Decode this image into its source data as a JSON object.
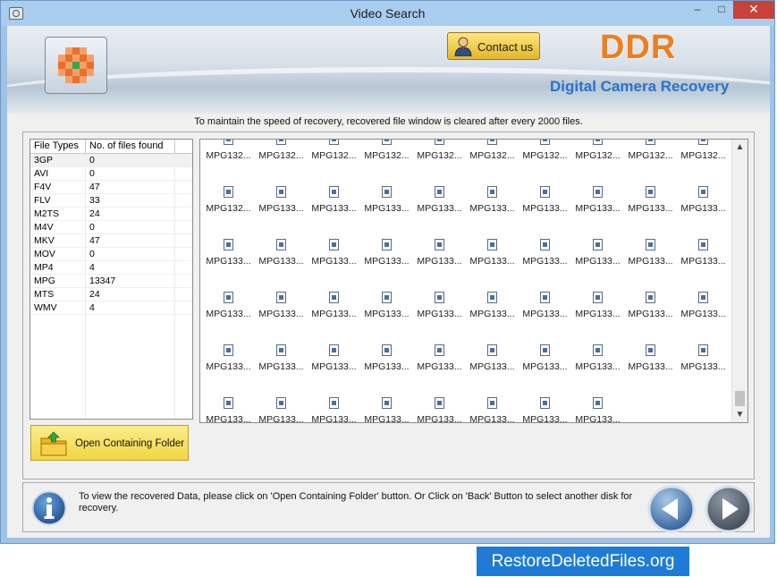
{
  "window": {
    "title": "Video Search",
    "minimize": "–",
    "maximize": "□",
    "close": "✕"
  },
  "header": {
    "contact_label": "Contact us",
    "brand": "DDR",
    "product": "Digital Camera Recovery"
  },
  "notice": "To maintain the speed of recovery, recovered file window is cleared after every 2000 files.",
  "file_types": {
    "columns": [
      "File Types",
      "No. of files found"
    ],
    "rows": [
      {
        "type": "3GP",
        "count": "0"
      },
      {
        "type": "AVI",
        "count": "0"
      },
      {
        "type": "F4V",
        "count": "47"
      },
      {
        "type": "FLV",
        "count": "33"
      },
      {
        "type": "M2TS",
        "count": "24"
      },
      {
        "type": "M4V",
        "count": "0"
      },
      {
        "type": "MKV",
        "count": "47"
      },
      {
        "type": "MOV",
        "count": "0"
      },
      {
        "type": "MP4",
        "count": "4"
      },
      {
        "type": "MPG",
        "count": "13347"
      },
      {
        "type": "MTS",
        "count": "24"
      },
      {
        "type": "WMV",
        "count": "4"
      }
    ]
  },
  "open_folder_label": "Open Containing Folder",
  "files": {
    "rows": [
      [
        "MPG132...",
        "MPG132...",
        "MPG132...",
        "MPG132...",
        "MPG132...",
        "MPG132...",
        "MPG132...",
        "MPG132...",
        "MPG132...",
        "MPG132..."
      ],
      [
        "MPG132...",
        "MPG133...",
        "MPG133...",
        "MPG133...",
        "MPG133...",
        "MPG133...",
        "MPG133...",
        "MPG133...",
        "MPG133...",
        "MPG133..."
      ],
      [
        "MPG133...",
        "MPG133...",
        "MPG133...",
        "MPG133...",
        "MPG133...",
        "MPG133...",
        "MPG133...",
        "MPG133...",
        "MPG133...",
        "MPG133..."
      ],
      [
        "MPG133...",
        "MPG133...",
        "MPG133...",
        "MPG133...",
        "MPG133...",
        "MPG133...",
        "MPG133...",
        "MPG133...",
        "MPG133...",
        "MPG133..."
      ],
      [
        "MPG133...",
        "MPG133...",
        "MPG133...",
        "MPG133...",
        "MPG133...",
        "MPG133...",
        "MPG133...",
        "MPG133...",
        "MPG133...",
        "MPG133..."
      ],
      [
        "MPG133...",
        "MPG133...",
        "MPG133...",
        "MPG133...",
        "MPG133...",
        "MPG133...",
        "MPG133...",
        "MPG133..."
      ]
    ]
  },
  "bottom_message": "To view the recovered Data, please click on 'Open Containing Folder' button. Or Click on 'Back' Button to select another disk for recovery.",
  "footer_brand": "RestoreDeletedFiles.org",
  "colors": {
    "brand_orange": "#ee7e1f",
    "product_blue": "#2a73c8",
    "footer_blue": "#1f7bd6"
  }
}
